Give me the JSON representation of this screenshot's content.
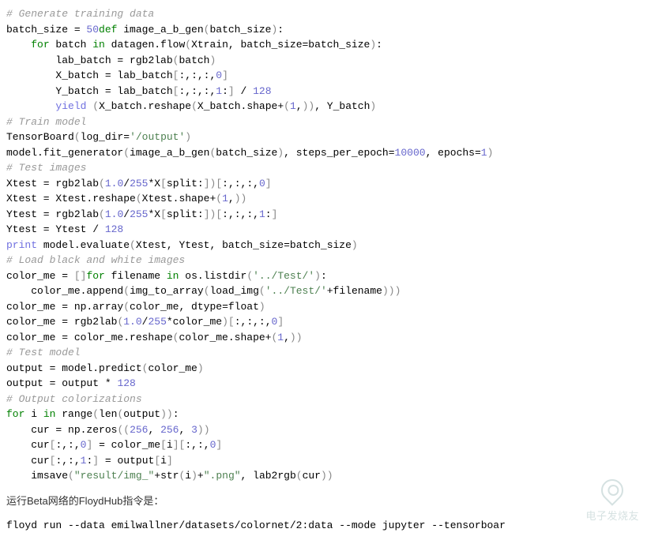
{
  "lines": [
    {
      "indent": 0,
      "tokens": [
        {
          "t": "# Generate training data",
          "c": "comment"
        }
      ]
    },
    {
      "indent": 0,
      "tokens": [
        {
          "t": "batch_size = "
        },
        {
          "t": "50",
          "c": "number"
        },
        {
          "t": "def",
          "c": "keyword"
        },
        {
          "t": " image_a_b_gen"
        },
        {
          "t": "(",
          "c": "paren"
        },
        {
          "t": "batch_size"
        },
        {
          "t": ")",
          "c": "paren"
        },
        {
          "t": ":"
        }
      ]
    },
    {
      "indent": 1,
      "tokens": [
        {
          "t": "for",
          "c": "keyword"
        },
        {
          "t": " batch "
        },
        {
          "t": "in",
          "c": "keyword"
        },
        {
          "t": " datagen.flow"
        },
        {
          "t": "(",
          "c": "paren"
        },
        {
          "t": "Xtrain, batch_size=batch_size"
        },
        {
          "t": ")",
          "c": "paren"
        },
        {
          "t": ":"
        }
      ]
    },
    {
      "indent": 2,
      "tokens": [
        {
          "t": "lab_batch = rgb2lab"
        },
        {
          "t": "(",
          "c": "paren"
        },
        {
          "t": "batch"
        },
        {
          "t": ")",
          "c": "paren"
        }
      ]
    },
    {
      "indent": 2,
      "tokens": [
        {
          "t": "X_batch = lab_batch"
        },
        {
          "t": "[",
          "c": "paren"
        },
        {
          "t": ":,:,:,"
        },
        {
          "t": "0",
          "c": "number"
        },
        {
          "t": "]",
          "c": "paren"
        }
      ]
    },
    {
      "indent": 2,
      "tokens": [
        {
          "t": "Y_batch = lab_batch"
        },
        {
          "t": "[",
          "c": "paren"
        },
        {
          "t": ":,:,:,"
        },
        {
          "t": "1",
          "c": "number"
        },
        {
          "t": ":"
        },
        {
          "t": "]",
          "c": "paren"
        },
        {
          "t": " / "
        },
        {
          "t": "128",
          "c": "number"
        }
      ]
    },
    {
      "indent": 2,
      "tokens": [
        {
          "t": "yield",
          "c": "builtin"
        },
        {
          "t": " "
        },
        {
          "t": "(",
          "c": "paren"
        },
        {
          "t": "X_batch.reshape"
        },
        {
          "t": "(",
          "c": "paren"
        },
        {
          "t": "X_batch.shape+"
        },
        {
          "t": "(",
          "c": "paren"
        },
        {
          "t": "1",
          "c": "number"
        },
        {
          "t": ","
        },
        {
          "t": ")",
          "c": "paren"
        },
        {
          "t": ")",
          "c": "paren"
        },
        {
          "t": ", Y_batch"
        },
        {
          "t": ")",
          "c": "paren"
        }
      ]
    },
    {
      "indent": 0,
      "tokens": [
        {
          "t": "# Train model",
          "c": "comment"
        }
      ]
    },
    {
      "indent": 0,
      "tokens": [
        {
          "t": "TensorBoard"
        },
        {
          "t": "(",
          "c": "paren"
        },
        {
          "t": "log_dir="
        },
        {
          "t": "'/output'",
          "c": "string"
        },
        {
          "t": ")",
          "c": "paren"
        }
      ]
    },
    {
      "indent": 0,
      "tokens": [
        {
          "t": "model.fit_generator"
        },
        {
          "t": "(",
          "c": "paren"
        },
        {
          "t": "image_a_b_gen"
        },
        {
          "t": "(",
          "c": "paren"
        },
        {
          "t": "batch_size"
        },
        {
          "t": ")",
          "c": "paren"
        },
        {
          "t": ", steps_per_epoch="
        },
        {
          "t": "10000",
          "c": "number"
        },
        {
          "t": ", epochs="
        },
        {
          "t": "1",
          "c": "number"
        },
        {
          "t": ")",
          "c": "paren"
        }
      ]
    },
    {
      "indent": 0,
      "tokens": [
        {
          "t": "# Test images",
          "c": "comment"
        }
      ]
    },
    {
      "indent": 0,
      "tokens": [
        {
          "t": "Xtest = rgb2lab"
        },
        {
          "t": "(",
          "c": "paren"
        },
        {
          "t": "1.0",
          "c": "number"
        },
        {
          "t": "/"
        },
        {
          "t": "255",
          "c": "number"
        },
        {
          "t": "*X"
        },
        {
          "t": "[",
          "c": "paren"
        },
        {
          "t": "split:"
        },
        {
          "t": "]",
          "c": "paren"
        },
        {
          "t": ")",
          "c": "paren"
        },
        {
          "t": "[",
          "c": "paren"
        },
        {
          "t": ":,:,:,"
        },
        {
          "t": "0",
          "c": "number"
        },
        {
          "t": "]",
          "c": "paren"
        }
      ]
    },
    {
      "indent": 0,
      "tokens": [
        {
          "t": "Xtest = Xtest.reshape"
        },
        {
          "t": "(",
          "c": "paren"
        },
        {
          "t": "Xtest.shape+"
        },
        {
          "t": "(",
          "c": "paren"
        },
        {
          "t": "1",
          "c": "number"
        },
        {
          "t": ","
        },
        {
          "t": ")",
          "c": "paren"
        },
        {
          "t": ")",
          "c": "paren"
        }
      ]
    },
    {
      "indent": 0,
      "tokens": [
        {
          "t": "Ytest = rgb2lab"
        },
        {
          "t": "(",
          "c": "paren"
        },
        {
          "t": "1.0",
          "c": "number"
        },
        {
          "t": "/"
        },
        {
          "t": "255",
          "c": "number"
        },
        {
          "t": "*X"
        },
        {
          "t": "[",
          "c": "paren"
        },
        {
          "t": "split:"
        },
        {
          "t": "]",
          "c": "paren"
        },
        {
          "t": ")",
          "c": "paren"
        },
        {
          "t": "[",
          "c": "paren"
        },
        {
          "t": ":,:,:,"
        },
        {
          "t": "1",
          "c": "number"
        },
        {
          "t": ":"
        },
        {
          "t": "]",
          "c": "paren"
        }
      ]
    },
    {
      "indent": 0,
      "tokens": [
        {
          "t": "Ytest = Ytest / "
        },
        {
          "t": "128",
          "c": "number"
        }
      ]
    },
    {
      "indent": 0,
      "tokens": [
        {
          "t": "print",
          "c": "builtin"
        },
        {
          "t": " model.evaluate"
        },
        {
          "t": "(",
          "c": "paren"
        },
        {
          "t": "Xtest, Ytest, batch_size=batch_size"
        },
        {
          "t": ")",
          "c": "paren"
        }
      ]
    },
    {
      "indent": 0,
      "tokens": [
        {
          "t": "# Load black and white images",
          "c": "comment"
        }
      ]
    },
    {
      "indent": 0,
      "tokens": [
        {
          "t": "color_me = "
        },
        {
          "t": "[",
          "c": "paren"
        },
        {
          "t": "]",
          "c": "paren"
        },
        {
          "t": "for",
          "c": "keyword"
        },
        {
          "t": " filename "
        },
        {
          "t": "in",
          "c": "keyword"
        },
        {
          "t": " os.listdir"
        },
        {
          "t": "(",
          "c": "paren"
        },
        {
          "t": "'../Test/'",
          "c": "string"
        },
        {
          "t": ")",
          "c": "paren"
        },
        {
          "t": ":"
        }
      ]
    },
    {
      "indent": 1,
      "tokens": [
        {
          "t": "color_me.append"
        },
        {
          "t": "(",
          "c": "paren"
        },
        {
          "t": "img_to_array"
        },
        {
          "t": "(",
          "c": "paren"
        },
        {
          "t": "load_img"
        },
        {
          "t": "(",
          "c": "paren"
        },
        {
          "t": "'../Test/'",
          "c": "string"
        },
        {
          "t": "+filename"
        },
        {
          "t": ")",
          "c": "paren"
        },
        {
          "t": ")",
          "c": "paren"
        },
        {
          "t": ")",
          "c": "paren"
        }
      ]
    },
    {
      "indent": 0,
      "tokens": [
        {
          "t": "color_me = np.array"
        },
        {
          "t": "(",
          "c": "paren"
        },
        {
          "t": "color_me, dtype=float"
        },
        {
          "t": ")",
          "c": "paren"
        }
      ]
    },
    {
      "indent": 0,
      "tokens": [
        {
          "t": "color_me = rgb2lab"
        },
        {
          "t": "(",
          "c": "paren"
        },
        {
          "t": "1.0",
          "c": "number"
        },
        {
          "t": "/"
        },
        {
          "t": "255",
          "c": "number"
        },
        {
          "t": "*color_me"
        },
        {
          "t": ")",
          "c": "paren"
        },
        {
          "t": "[",
          "c": "paren"
        },
        {
          "t": ":,:,:,"
        },
        {
          "t": "0",
          "c": "number"
        },
        {
          "t": "]",
          "c": "paren"
        }
      ]
    },
    {
      "indent": 0,
      "tokens": [
        {
          "t": "color_me = color_me.reshape"
        },
        {
          "t": "(",
          "c": "paren"
        },
        {
          "t": "color_me.shape+"
        },
        {
          "t": "(",
          "c": "paren"
        },
        {
          "t": "1",
          "c": "number"
        },
        {
          "t": ","
        },
        {
          "t": ")",
          "c": "paren"
        },
        {
          "t": ")",
          "c": "paren"
        }
      ]
    },
    {
      "indent": 0,
      "tokens": [
        {
          "t": "# Test model",
          "c": "comment"
        }
      ]
    },
    {
      "indent": 0,
      "tokens": [
        {
          "t": "output = model.predict"
        },
        {
          "t": "(",
          "c": "paren"
        },
        {
          "t": "color_me"
        },
        {
          "t": ")",
          "c": "paren"
        }
      ]
    },
    {
      "indent": 0,
      "tokens": [
        {
          "t": "output = output * "
        },
        {
          "t": "128",
          "c": "number"
        }
      ]
    },
    {
      "indent": 0,
      "tokens": [
        {
          "t": "# Output colorizations",
          "c": "comment"
        }
      ]
    },
    {
      "indent": 0,
      "tokens": [
        {
          "t": "for",
          "c": "keyword"
        },
        {
          "t": " i "
        },
        {
          "t": "in",
          "c": "keyword"
        },
        {
          "t": " range"
        },
        {
          "t": "(",
          "c": "paren"
        },
        {
          "t": "len"
        },
        {
          "t": "(",
          "c": "paren"
        },
        {
          "t": "output"
        },
        {
          "t": ")",
          "c": "paren"
        },
        {
          "t": ")",
          "c": "paren"
        },
        {
          "t": ":"
        }
      ]
    },
    {
      "indent": 1,
      "tokens": [
        {
          "t": "cur = np.zeros"
        },
        {
          "t": "(",
          "c": "paren"
        },
        {
          "t": "(",
          "c": "paren"
        },
        {
          "t": "256",
          "c": "number"
        },
        {
          "t": ", "
        },
        {
          "t": "256",
          "c": "number"
        },
        {
          "t": ", "
        },
        {
          "t": "3",
          "c": "number"
        },
        {
          "t": ")",
          "c": "paren"
        },
        {
          "t": ")",
          "c": "paren"
        }
      ]
    },
    {
      "indent": 1,
      "tokens": [
        {
          "t": "cur"
        },
        {
          "t": "[",
          "c": "paren"
        },
        {
          "t": ":,:,"
        },
        {
          "t": "0",
          "c": "number"
        },
        {
          "t": "]",
          "c": "paren"
        },
        {
          "t": " = color_me"
        },
        {
          "t": "[",
          "c": "paren"
        },
        {
          "t": "i"
        },
        {
          "t": "]",
          "c": "paren"
        },
        {
          "t": "[",
          "c": "paren"
        },
        {
          "t": ":,:,"
        },
        {
          "t": "0",
          "c": "number"
        },
        {
          "t": "]",
          "c": "paren"
        }
      ]
    },
    {
      "indent": 1,
      "tokens": [
        {
          "t": "cur"
        },
        {
          "t": "[",
          "c": "paren"
        },
        {
          "t": ":,:,"
        },
        {
          "t": "1",
          "c": "number"
        },
        {
          "t": ":"
        },
        {
          "t": "]",
          "c": "paren"
        },
        {
          "t": " = output"
        },
        {
          "t": "[",
          "c": "paren"
        },
        {
          "t": "i"
        },
        {
          "t": "]",
          "c": "paren"
        }
      ]
    },
    {
      "indent": 1,
      "tokens": [
        {
          "t": "imsave"
        },
        {
          "t": "(",
          "c": "paren"
        },
        {
          "t": "\"result/img_\"",
          "c": "string"
        },
        {
          "t": "+str"
        },
        {
          "t": "(",
          "c": "paren"
        },
        {
          "t": "i"
        },
        {
          "t": ")",
          "c": "paren"
        },
        {
          "t": "+"
        },
        {
          "t": "\".png\"",
          "c": "string"
        },
        {
          "t": ", lab2rgb"
        },
        {
          "t": "(",
          "c": "paren"
        },
        {
          "t": "cur"
        },
        {
          "t": ")",
          "c": "paren"
        },
        {
          "t": ")",
          "c": "paren"
        }
      ]
    }
  ],
  "prose": "运行Beta网络的FloydHub指令是：",
  "cmd": "floyd run --data emilwallner/datasets/colornet/2:data --mode jupyter --tensorboar",
  "watermark": "电子发烧友"
}
